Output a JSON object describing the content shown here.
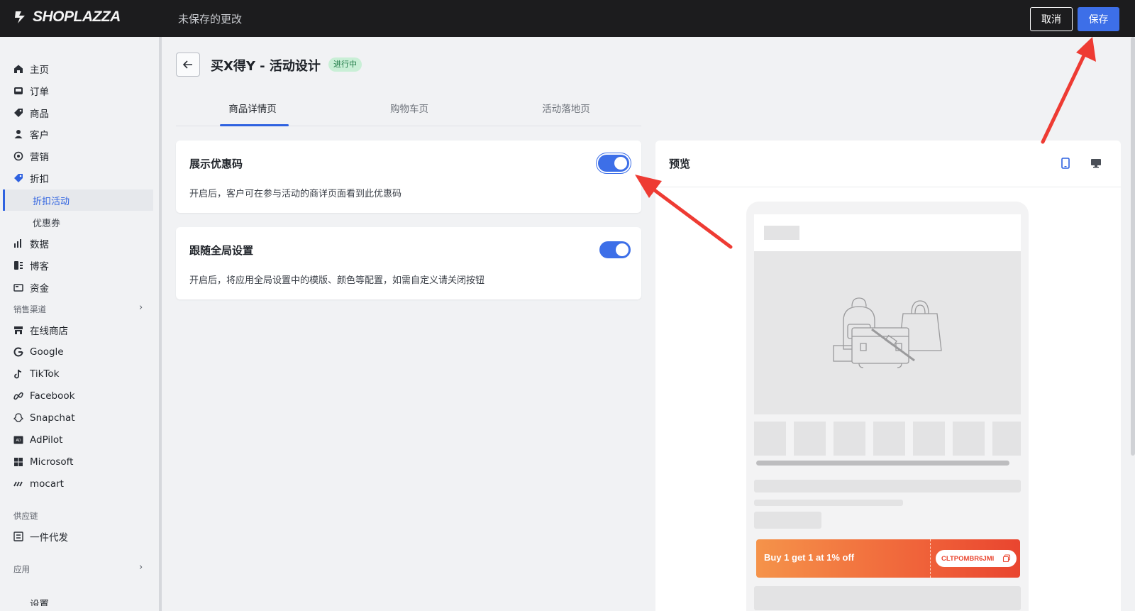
{
  "header": {
    "brand": "SHOPLAZZA",
    "unsaved_text": "未保存的更改",
    "cancel_label": "取消",
    "save_label": "保存"
  },
  "sidebar": {
    "items": [
      {
        "label": "主页",
        "icon": "home-icon"
      },
      {
        "label": "订单",
        "icon": "inbox-icon"
      },
      {
        "label": "商品",
        "icon": "tag-icon"
      },
      {
        "label": "客户",
        "icon": "person-icon"
      },
      {
        "label": "营销",
        "icon": "target-icon"
      },
      {
        "label": "折扣",
        "icon": "discount-tag-icon"
      }
    ],
    "discount_sub": [
      {
        "label": "折扣活动",
        "active": true
      },
      {
        "label": "优惠券",
        "active": false
      }
    ],
    "items2": [
      {
        "label": "数据",
        "icon": "bar-chart-icon"
      },
      {
        "label": "博客",
        "icon": "blog-icon"
      },
      {
        "label": "资金",
        "icon": "wallet-icon"
      }
    ],
    "sales_channels_label": "销售渠道",
    "channels": [
      {
        "label": "在线商店",
        "icon": "store-icon"
      },
      {
        "label": "Google",
        "icon": "google-icon"
      },
      {
        "label": "TikTok",
        "icon": "tiktok-icon"
      },
      {
        "label": "Facebook",
        "icon": "meta-icon"
      },
      {
        "label": "Snapchat",
        "icon": "snapchat-icon"
      },
      {
        "label": "AdPilot",
        "icon": "ad-icon"
      },
      {
        "label": "Microsoft",
        "icon": "microsoft-icon"
      },
      {
        "label": "mocart",
        "icon": "mocart-icon"
      }
    ],
    "supply_chain_label": "供应链",
    "supply_items": [
      {
        "label": "一件代发",
        "icon": "dropship-icon"
      }
    ],
    "apps_label": "应用",
    "settings_label": "设置"
  },
  "page": {
    "title": "买X得Y - 活动设计",
    "status": "进行中",
    "tabs": [
      {
        "label": "商品详情页",
        "active": true
      },
      {
        "label": "购物车页",
        "active": false
      },
      {
        "label": "活动落地页",
        "active": false
      }
    ],
    "cards": [
      {
        "title": "展示优惠码",
        "desc": "开启后，客户可在参与活动的商详页面看到此优惠码",
        "enabled": true
      },
      {
        "title": "跟随全局设置",
        "desc": "开启后，将应用全局设置中的模版、颜色等配置，如需自定义请关闭按钮",
        "enabled": true
      }
    ]
  },
  "preview": {
    "title": "预览",
    "coupon_text": "Buy 1 get 1 at 1% off",
    "coupon_code": "CLTPOMBR6JMI"
  },
  "colors": {
    "accent": "#3d6fe8",
    "topbar": "#1c1c1e",
    "badge_bg": "#c9efd6",
    "annotation_arrow": "#ee3b33"
  }
}
